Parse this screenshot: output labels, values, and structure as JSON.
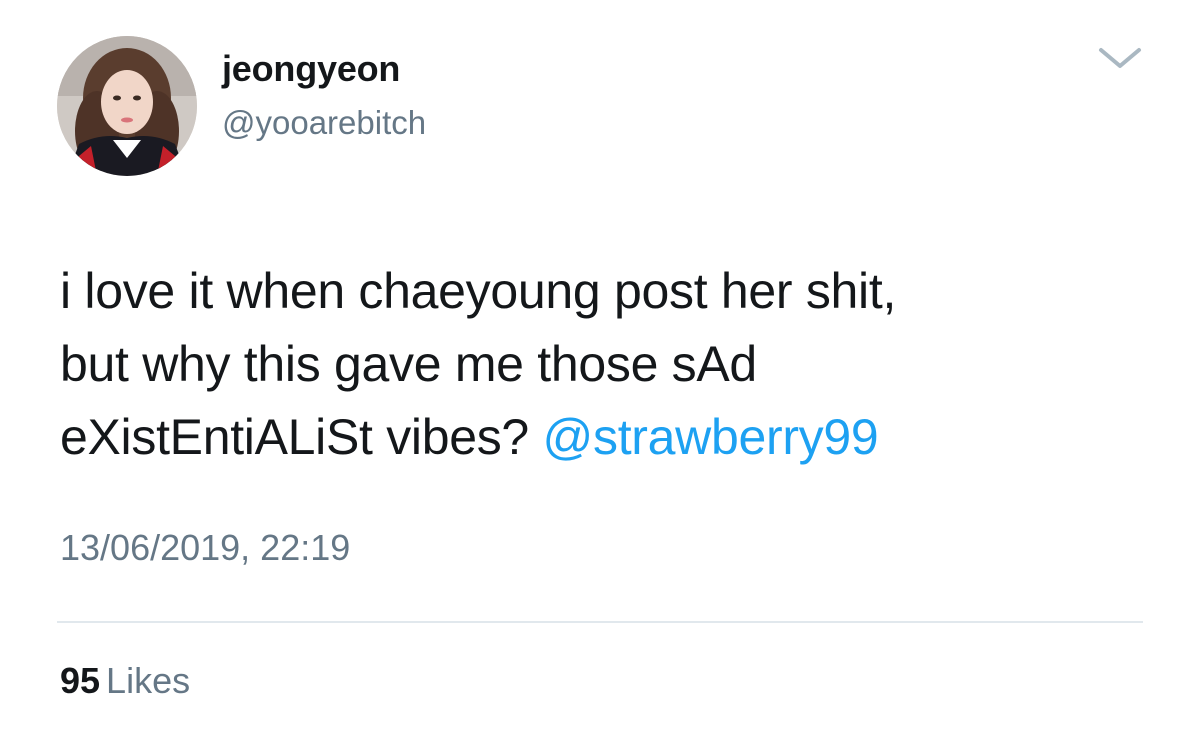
{
  "tweet": {
    "author": {
      "display_name": "jeongyeon",
      "handle": "@yooarebitch"
    },
    "text_lines": [
      "i love it when chaeyoung post her shit,",
      "but why this gave me those sAd",
      "eXistEntiALiSt vibes? "
    ],
    "mention": "@strawberry99",
    "timestamp": "13/06/2019, 22:19",
    "likes": {
      "count": "95",
      "label": "Likes"
    }
  },
  "colors": {
    "text": "#14171a",
    "secondary": "#657786",
    "link": "#1da1f2",
    "divider": "#e1e8ed",
    "chevron": "#aab8c2"
  },
  "icons": {
    "menu": "chevron-down-icon"
  }
}
